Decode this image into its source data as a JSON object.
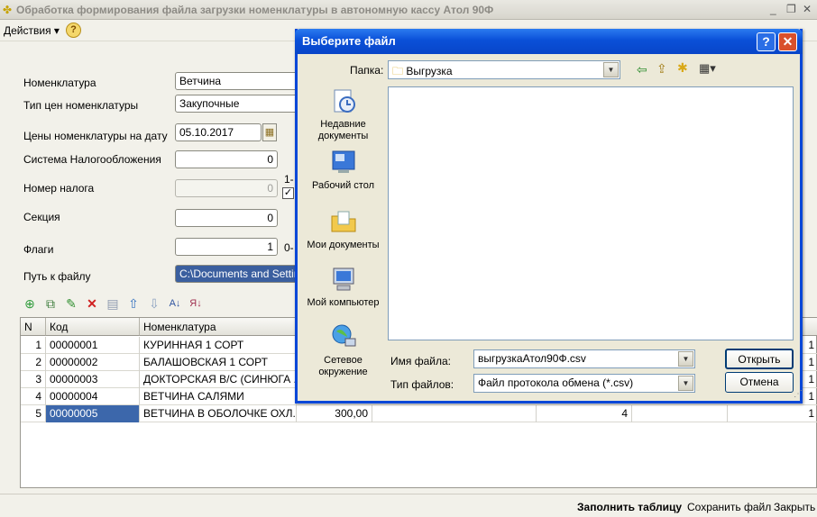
{
  "window": {
    "title": "Обработка формирования файла загрузки номенклатуры в автономную кассу  Атол 90Ф"
  },
  "menu": {
    "actions_label": "Действия ▾",
    "help_glyph": "?"
  },
  "form": {
    "nomenclature": {
      "label": "Номенклатура",
      "value": "Ветчина"
    },
    "price_type": {
      "label": "Тип цен номенклатуры",
      "value": "Закупочные"
    },
    "price_date": {
      "label": "Цены номенклатуры на дату",
      "value": "05.10.2017"
    },
    "tax_system": {
      "label": "Система Налогообложения",
      "value": "0"
    },
    "tax_number": {
      "label": "Номер налога",
      "value": "0",
      "side_text": "1-"
    },
    "section": {
      "label": "Секция",
      "value": "0"
    },
    "flags": {
      "label": "Флаги",
      "value": "1",
      "side_text": "0-"
    },
    "file_path": {
      "label": "Путь к файлу",
      "value": "C:\\Documents and Settings"
    }
  },
  "table": {
    "columns": [
      "N",
      "Код",
      "Номенклатура"
    ],
    "rows": [
      {
        "n": "1",
        "code": "00000001",
        "name": "КУРИННАЯ 1 СОРТ",
        "right": "1"
      },
      {
        "n": "2",
        "code": "00000002",
        "name": "БАЛАШОВСКАЯ 1 СОРТ",
        "right": "1"
      },
      {
        "n": "3",
        "code": "00000003",
        "name": "ДОКТОРСКАЯ В/С (СИНЮГА ...",
        "right": "1"
      },
      {
        "n": "4",
        "code": "00000004",
        "name": "ВЕТЧИНА САЛЯМИ",
        "right": "1"
      },
      {
        "n": "5",
        "code": "00000005",
        "name": "ВЕТЧИНА В ОБОЛОЧКЕ ОХЛ.",
        "price": "300,00",
        "qty": "4",
        "right": "1"
      }
    ]
  },
  "bottom": {
    "fill_label": "Заполнить таблицу",
    "save_label": "Сохранить файл",
    "close_label": "Закрыть"
  },
  "dialog": {
    "title": "Выберите файл",
    "help_glyph": "?",
    "close_glyph": "✕",
    "folder_label": "Папка:",
    "folder_value": "Выгрузка",
    "places": [
      {
        "label": "Недавние документы"
      },
      {
        "label": "Рабочий стол"
      },
      {
        "label": "Мои документы"
      },
      {
        "label": "Мой компьютер"
      },
      {
        "label": "Сетевое окружение"
      }
    ],
    "filename_label": "Имя файла:",
    "filename_value": "выгрузкаАтол90Ф.csv",
    "filetype_label": "Тип файлов:",
    "filetype_value": "Файл протокола обмена (*.csv)",
    "open_label": "Открыть",
    "cancel_label": "Отмена"
  },
  "colors": {
    "dialog_title": "#0a50d8",
    "selection": "#3c67ab"
  }
}
